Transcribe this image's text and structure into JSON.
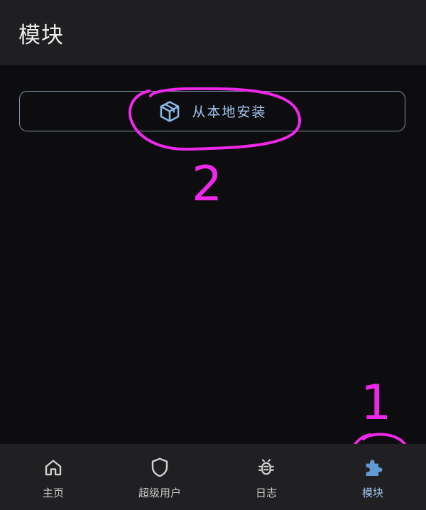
{
  "app_bar": {
    "title": "模块"
  },
  "main": {
    "install_button": {
      "label": "从本地安装",
      "icon": "package-icon"
    }
  },
  "annotations": {
    "step_1": "1",
    "step_2": "2",
    "color": "#ee28e8"
  },
  "bottom_nav": {
    "items": [
      {
        "label": "主页",
        "icon": "home-icon"
      },
      {
        "label": "超级用户",
        "icon": "shield-icon"
      },
      {
        "label": "日志",
        "icon": "bug-icon"
      },
      {
        "label": "模块",
        "icon": "puzzle-icon"
      }
    ],
    "active_index": 3
  },
  "colors": {
    "background": "#0d0d0f",
    "bar": "#1f1f21",
    "accent": "#9ec2ea",
    "annotation": "#ee28e8"
  }
}
